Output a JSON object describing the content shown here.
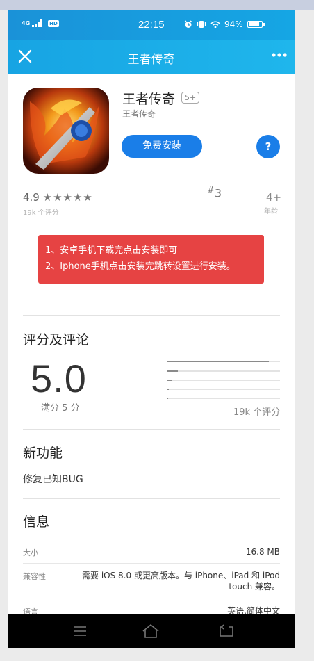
{
  "status_bar": {
    "network": "4G",
    "hd": "HD",
    "time": "22:15",
    "battery": "94%"
  },
  "nav": {
    "title": "王者传奇",
    "close_icon": "close-icon",
    "more_icon": "more-icon"
  },
  "app": {
    "name": "王者传奇",
    "age_tag": "5+",
    "developer": "王者传奇",
    "install_label": "免费安装",
    "help_label": "?"
  },
  "stats": {
    "rating": "4.9",
    "stars": "★★★★★",
    "rating_count": "19k 个评分",
    "rank_prefix": "#",
    "rank_number": "3",
    "age": "4+",
    "age_label": "年龄"
  },
  "notice": {
    "line1": "1、安卓手机下载完点击安装即可",
    "line2": "2、Iphone手机点击安装完跳转设置进行安装。"
  },
  "ratings": {
    "title": "评分及评论",
    "score": "5.0",
    "out_of": "满分 5 分",
    "count": "19k 个评分",
    "distribution": [
      0.9,
      0.1,
      0.04,
      0.02,
      0.01
    ]
  },
  "whats_new": {
    "title": "新功能",
    "text": "修复已知BUG"
  },
  "info": {
    "title": "信息",
    "rows": [
      {
        "label": "大小",
        "value": "16.8 MB"
      },
      {
        "label": "兼容性",
        "value_line1": "需要 iOS 8.0 或更高版本。与 iPhone、iPad 和 iPod",
        "value_line2": "touch 兼容。"
      },
      {
        "label": "语言",
        "value": "英语,简体中文"
      }
    ]
  },
  "colors": {
    "nav_blue": "#17a4e3",
    "button_blue": "#1a7ee8",
    "notice_red": "#e64343"
  }
}
